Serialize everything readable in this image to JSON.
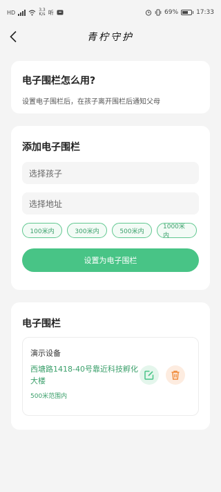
{
  "status_bar": {
    "left_network": "HD",
    "speed_value": "3.3",
    "speed_unit": "K/s",
    "hear_label": "听",
    "battery_percent": "69%",
    "time": "17:33"
  },
  "nav": {
    "title": "青柠守护"
  },
  "howto": {
    "title": "电子围栏怎么用?",
    "description": "设置电子围栏后，在孩子离开围栏后通知父母"
  },
  "add_fence": {
    "title": "添加电子围栏",
    "child_placeholder": "选择孩子",
    "address_placeholder": "选择地址",
    "radius_options": [
      "100米内",
      "300米内",
      "500米内",
      "1000米内"
    ],
    "submit_label": "设置为电子围栏"
  },
  "fence_list": {
    "title": "电子围栏",
    "items": [
      {
        "device": "演示设备",
        "address": "西塘路1418-40号靠近科技孵化大楼",
        "range": "500米范围内"
      }
    ]
  },
  "colors": {
    "accent": "#48c486",
    "accent_text": "#3a9f6a",
    "delete_accent": "#f08c3c",
    "background": "#f4f4f4"
  },
  "icons": {
    "back": "chevron-left-icon",
    "edit": "edit-icon",
    "delete": "trash-icon"
  }
}
